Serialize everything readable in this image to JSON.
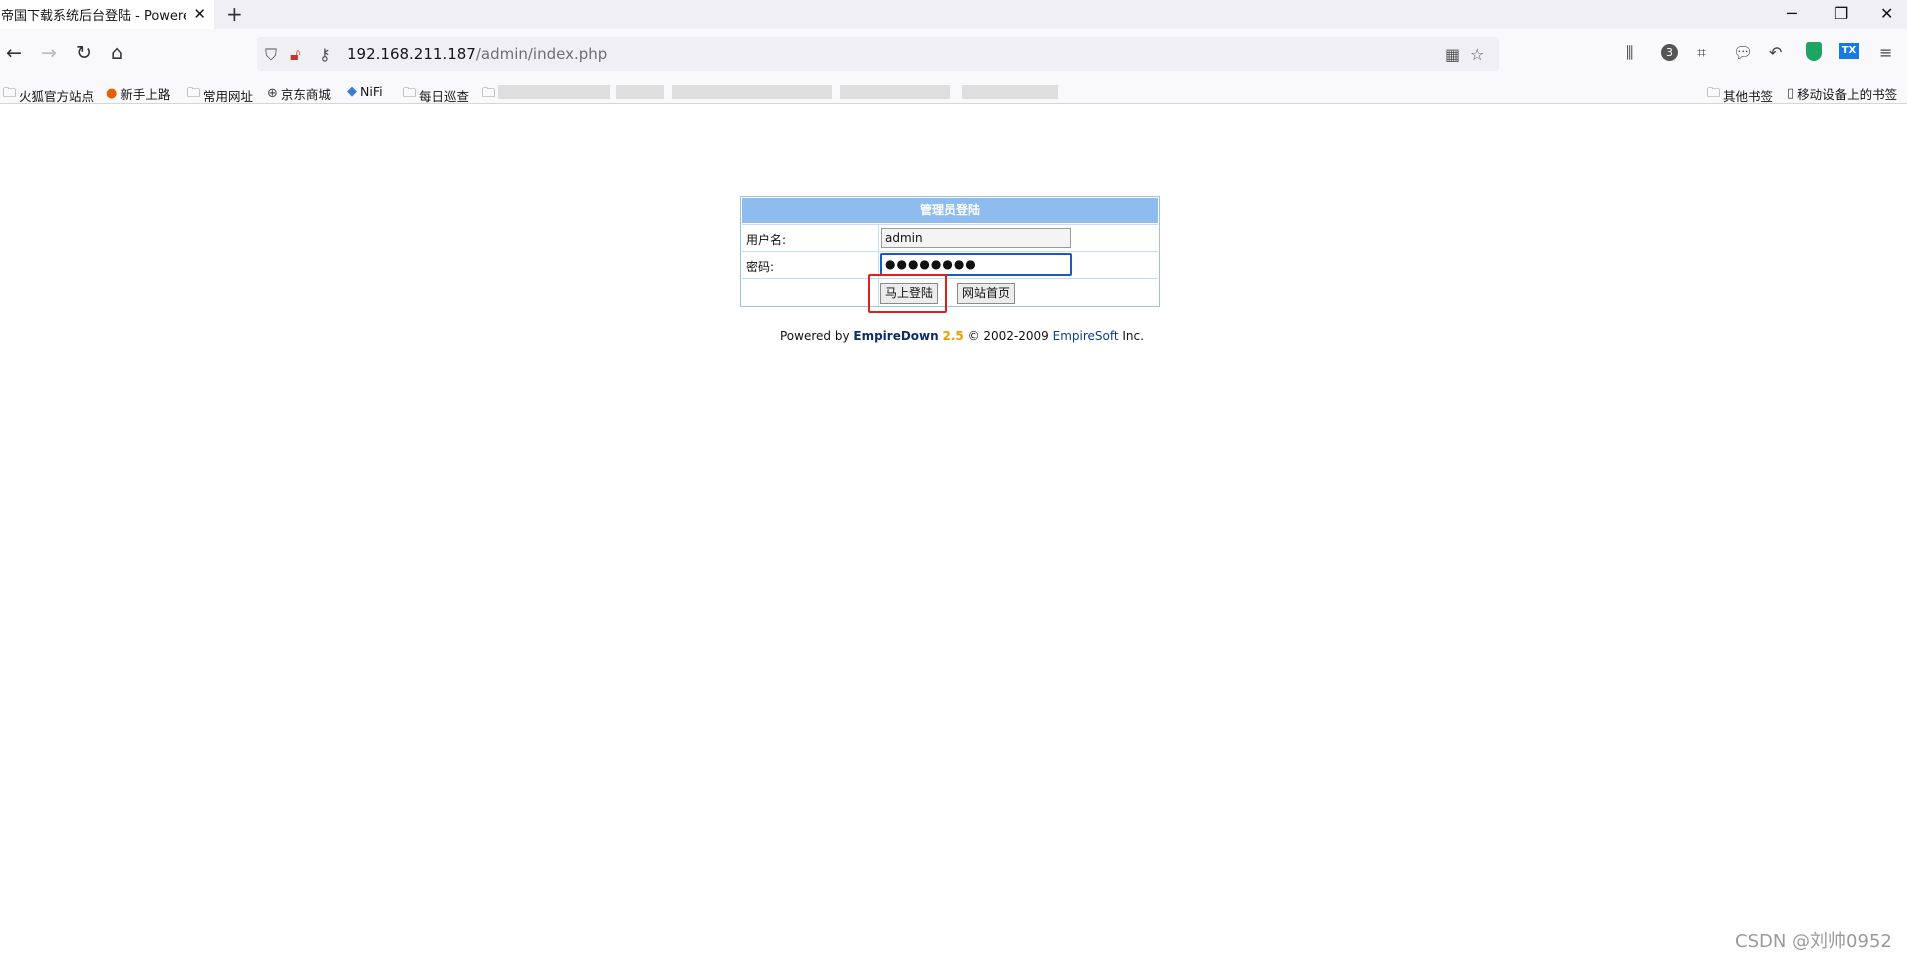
{
  "browser": {
    "tab": {
      "title": "帝国下载系统后台登陆 - Powered b",
      "close": "✕"
    },
    "new_tab": "+",
    "window_controls": {
      "minimize": "─",
      "restore": "❐",
      "close": "✕"
    },
    "url": {
      "host": "192.168.211.187",
      "path": "/admin/index.php"
    },
    "nav_icons": [
      "back-arrow-icon",
      "forward-arrow-icon",
      "reload-icon",
      "home-icon"
    ],
    "toolbar_badge": "3",
    "tx_label": "TX",
    "bookmarks": [
      {
        "label": "火狐官方站点",
        "icon": "folder-icon"
      },
      {
        "label": "新手上路",
        "icon": "firefox-icon"
      },
      {
        "label": "常用网址",
        "icon": "folder-icon"
      },
      {
        "label": "京东商城",
        "icon": "globe-icon"
      },
      {
        "label": "NiFi",
        "icon": "drop-icon"
      },
      {
        "label": "每日巡查",
        "icon": "folder-icon"
      }
    ],
    "bookmarks_right": [
      {
        "label": "其他书签",
        "icon": "folder-icon"
      },
      {
        "label": "移动设备上的书签",
        "icon": "mobile-icon"
      }
    ]
  },
  "login": {
    "header": "管理员登陆",
    "username_label": "用户名:",
    "username_value": "admin",
    "password_label": "密码:",
    "password_value": "●●●●●●●●",
    "login_button": "马上登陆",
    "home_button": "网站首页"
  },
  "footer": {
    "powered_prefix": "Powered by ",
    "brand": "EmpireDown",
    "version": "2.5",
    "copyright": " © 2002-2009 ",
    "company": "EmpireSoft",
    "suffix": " Inc."
  },
  "watermark": "CSDN @刘帅0952",
  "colors": {
    "header_bg": "#8fbcee",
    "border": "#9cc2ea",
    "highlight": "#e41d1d",
    "version": "#ee9a00"
  }
}
